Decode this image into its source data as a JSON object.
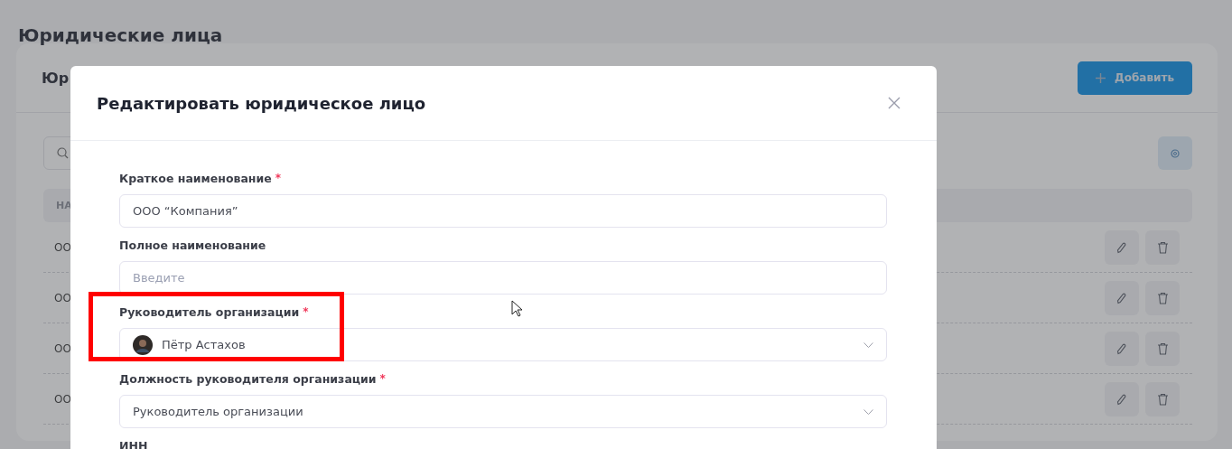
{
  "page": {
    "title": "Юридические лица"
  },
  "card": {
    "title": "Юр",
    "add_button": {
      "label": "Добавить"
    },
    "table": {
      "columns": [
        "НА"
      ],
      "rows": [
        {
          "cells": [
            "ОО"
          ]
        },
        {
          "cells": [
            "ОО"
          ]
        },
        {
          "cells": [
            "ОО"
          ]
        },
        {
          "cells": [
            "ОО"
          ]
        }
      ]
    }
  },
  "modal": {
    "title": "Редактировать юридическое лицо",
    "fields": [
      {
        "kind": "text",
        "label": "Краткое наименование",
        "required_mark": "*",
        "value": "ООО “Компания”"
      },
      {
        "kind": "text",
        "label": "Полное наименование",
        "placeholder": "Введите"
      },
      {
        "kind": "select",
        "label": "Руководитель организации",
        "required_mark": "*",
        "value": "Пётр Астахов",
        "avatar": true,
        "highlighted": true
      },
      {
        "kind": "select",
        "label": "Должность руководителя организации",
        "required_mark": "*",
        "value": "Руководитель организации"
      },
      {
        "kind": "label",
        "label": "ИНН"
      }
    ]
  }
}
